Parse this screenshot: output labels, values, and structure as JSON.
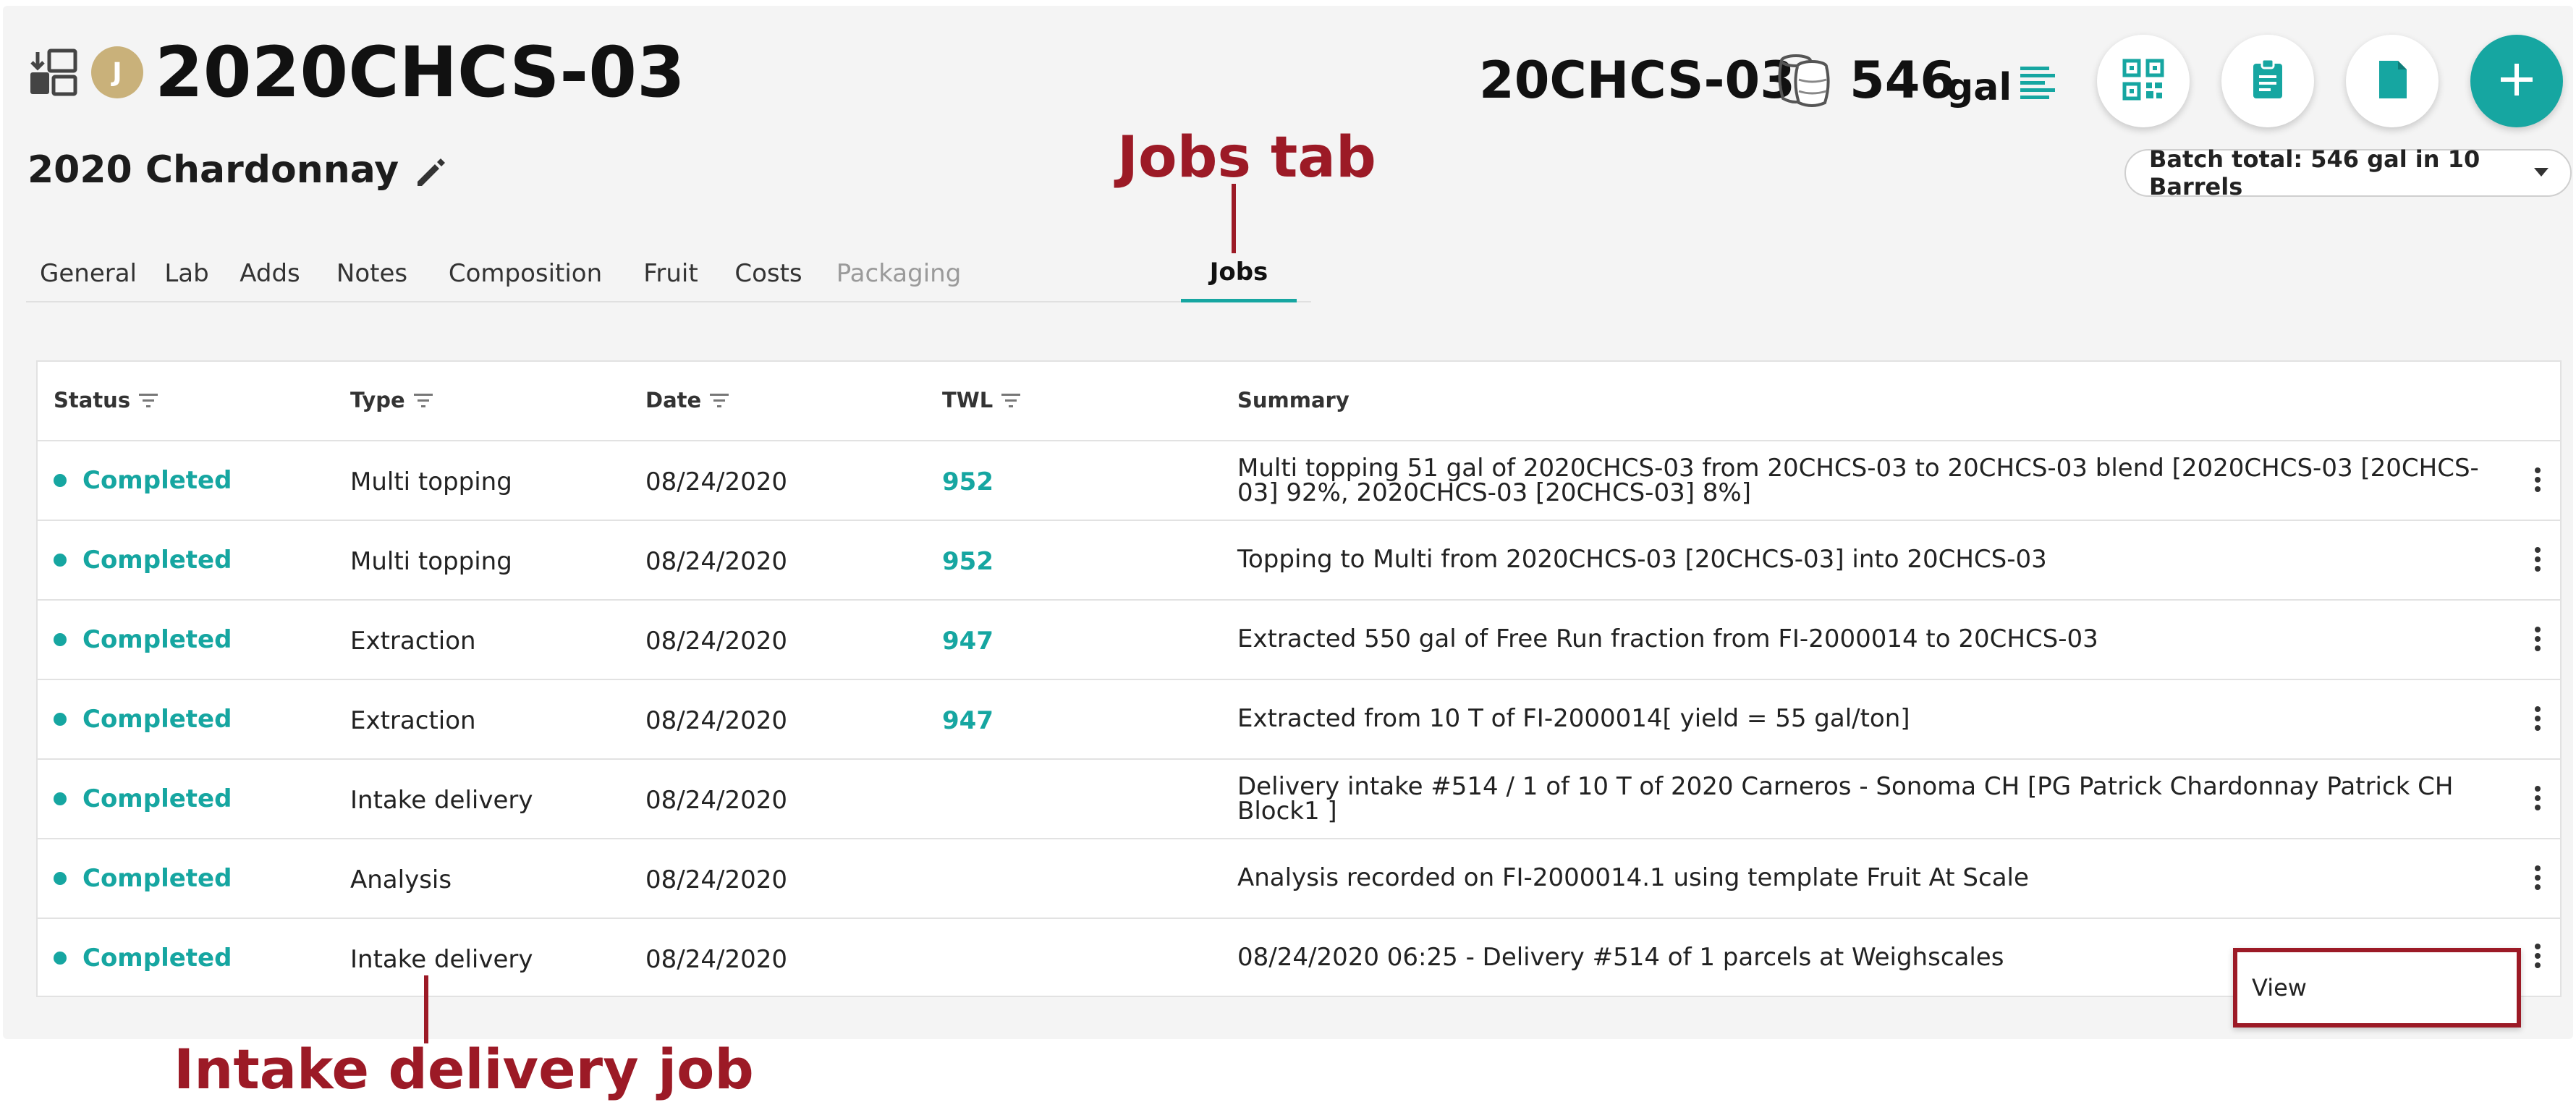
{
  "header": {
    "avatar_letter": "J",
    "lot_code": "2020CHCS-03",
    "lot_name": "2020 Chardonnay",
    "vessel_code": "20CHCS-03",
    "volume": "546",
    "unit": "gal",
    "batch_total": "Batch total: 546 gal in 10 Barrels"
  },
  "icons": {
    "header_left": "transfer-icon",
    "edit": "pencil-icon",
    "barrel": "barrel-icon",
    "details": "lines-icon",
    "actions": [
      "qr-code-icon",
      "clipboard-icon",
      "document-icon",
      "plus-icon"
    ]
  },
  "tabs": [
    {
      "label": "General"
    },
    {
      "label": "Lab"
    },
    {
      "label": "Adds"
    },
    {
      "label": "Notes"
    },
    {
      "label": "Composition"
    },
    {
      "label": "Fruit"
    },
    {
      "label": "Costs"
    },
    {
      "label": "Packaging"
    },
    {
      "label": "Jobs"
    }
  ],
  "annotations": {
    "jobs_tab": "Jobs tab",
    "intake_job": "Intake delivery job"
  },
  "table": {
    "headers": {
      "status": "Status",
      "type": "Type",
      "date": "Date",
      "twl": "TWL",
      "summary": "Summary"
    },
    "rows": [
      {
        "status": "Completed",
        "type": "Multi topping",
        "date": "08/24/2020",
        "twl": "952",
        "summary": "Multi topping 51 gal of 2020CHCS-03 from 20CHCS-03 to 20CHCS-03 blend [2020CHCS-03 [20CHCS-03] 92%, 2020CHCS-03 [20CHCS-03] 8%]"
      },
      {
        "status": "Completed",
        "type": "Multi topping",
        "date": "08/24/2020",
        "twl": "952",
        "summary": "Topping to Multi from 2020CHCS-03 [20CHCS-03] into 20CHCS-03"
      },
      {
        "status": "Completed",
        "type": "Extraction",
        "date": "08/24/2020",
        "twl": "947",
        "summary": "Extracted 550 gal of Free Run fraction from FI-2000014 to 20CHCS-03"
      },
      {
        "status": "Completed",
        "type": "Extraction",
        "date": "08/24/2020",
        "twl": "947",
        "summary": "Extracted from 10 T of FI-2000014[ yield = 55 gal/ton]"
      },
      {
        "status": "Completed",
        "type": "Intake delivery",
        "date": "08/24/2020",
        "twl": "",
        "summary": "Delivery intake #514 / 1 of 10 T of 2020 Carneros - Sonoma CH [PG Patrick Chardonnay Patrick CH Block1 ]"
      },
      {
        "status": "Completed",
        "type": "Analysis",
        "date": "08/24/2020",
        "twl": "",
        "summary": "Analysis recorded on FI-2000014.1 using template Fruit At Scale"
      },
      {
        "status": "Completed",
        "type": "Intake delivery",
        "date": "08/24/2020",
        "twl": "",
        "summary": "08/24/2020 06:25 - Delivery #514 of 1 parcels at Weighscales"
      }
    ]
  },
  "row_menu": {
    "view_label": "View"
  },
  "colors": {
    "accent": "#16a6a1",
    "annotation": "#9c1a26",
    "avatar": "#c9b17a"
  }
}
